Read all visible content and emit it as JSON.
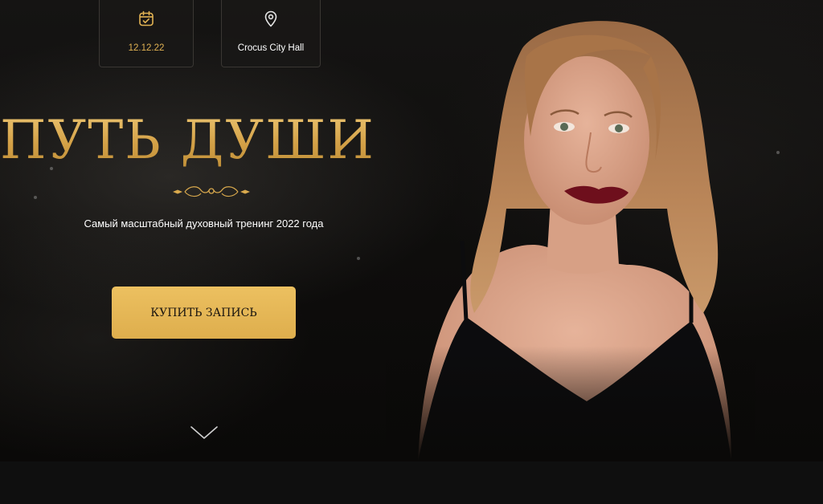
{
  "event": {
    "date": "12.12.22",
    "venue": "Crocus City Hall"
  },
  "hero": {
    "title": "ПУТЬ ДУШИ",
    "subtitle": "Самый масштабный духовный тренинг 2022 года",
    "cta_label": "КУПИТЬ ЗАПИСЬ"
  },
  "icons": {
    "date": "calendar-icon",
    "venue": "location-pin-icon",
    "scroll": "chevron-down-icon"
  },
  "colors": {
    "gold": "#d9a94d",
    "button": "#e6b757",
    "background": "#0e0d0c"
  }
}
